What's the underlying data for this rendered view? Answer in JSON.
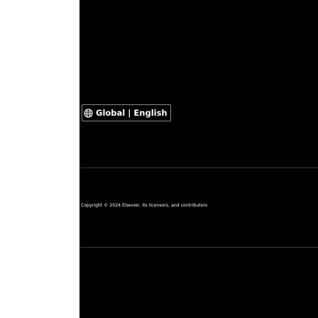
{
  "footer": {
    "language_selector": {
      "label": "Global | English",
      "icon": "globe-icon"
    },
    "copyright": "Copyright © 2024 Elsevier, its licensors, and contributors"
  },
  "colors": {
    "footer_background": "#000000",
    "footer_text": "#ffffff",
    "page_background": "#ffffff"
  }
}
